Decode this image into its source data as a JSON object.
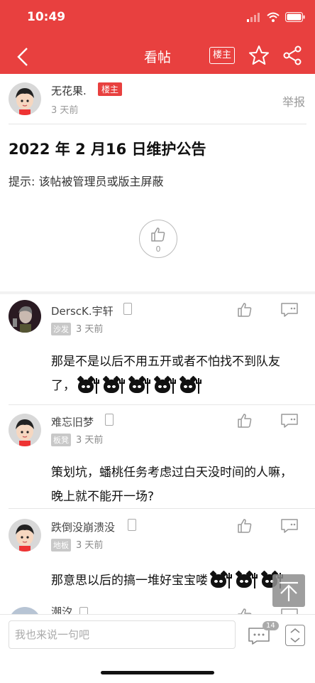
{
  "status": {
    "time": "10:49"
  },
  "nav": {
    "title": "看帖",
    "lz_label": "楼主"
  },
  "op": {
    "name": "无花果.",
    "badge": "楼主",
    "time": "3 天前",
    "report": "举报",
    "title": "2022 年 2 月16 日维护公告",
    "hint": "提示: 该帖被管理员或版主屏蔽",
    "likes": "0"
  },
  "replies": [
    {
      "name": "DerscK.宇轩",
      "floor": "沙发",
      "time": "3 天前",
      "text": "那是不是以后不用五开或者不怕找不到队友了，",
      "emoji_count": 5
    },
    {
      "name": "难忘旧梦",
      "floor": "板凳",
      "time": "3 天前",
      "text": "策划坑，蟠桃任务考虑过白天没时间的人嘛，晚上就不能开一场?"
    },
    {
      "name": "跌倒没崩溃没",
      "floor": "地板",
      "time": "3 天前",
      "text": "那意思以后的搞一堆好宝宝喽",
      "emoji_count": 3
    },
    {
      "name": "潮汐"
    }
  ],
  "bottom": {
    "input_placeholder": "我也来说一句吧",
    "comment_count": "14"
  },
  "colors": {
    "brand": "#e8403f"
  },
  "icons": [
    "back-icon",
    "star-icon",
    "share-icon",
    "thumbs-up-icon",
    "reply-icon",
    "phone-icon",
    "comment-icon",
    "sort-icon",
    "arrow-up-icon"
  ]
}
